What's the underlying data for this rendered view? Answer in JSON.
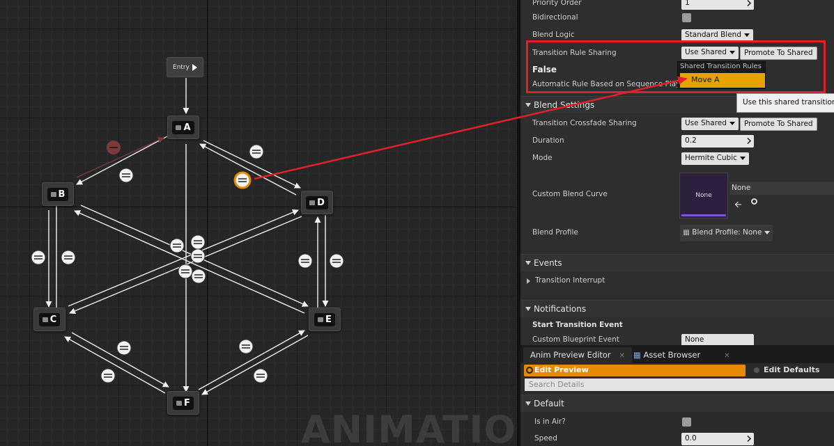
{
  "graph": {
    "entry_label": "Entry",
    "states": [
      "A",
      "B",
      "C",
      "D",
      "E",
      "F"
    ],
    "watermark": "ANIMATION"
  },
  "details": {
    "rows": {
      "priority_order": {
        "label": "Priority Order",
        "value": "1"
      },
      "bidirectional": {
        "label": "Bidirectional",
        "checked": false
      },
      "blend_logic": {
        "label": "Blend Logic",
        "value": "Standard Blend"
      },
      "transition_rule_sharing": {
        "label": "Transition Rule Sharing",
        "value": "Use Shared",
        "button": "Promote To Shared"
      },
      "false_label": "False",
      "automatic_rule": {
        "label": "Automatic Rule Based on Sequence Player"
      }
    },
    "dropdown": {
      "header": "Shared Transition Rules",
      "option": "Move A"
    },
    "tooltip": "Use this shared transition",
    "blend_settings": {
      "title": "Blend Settings",
      "crossfade_sharing": {
        "label": "Transition Crossfade Sharing",
        "value": "Use Shared",
        "button": "Promote To Shared"
      },
      "duration": {
        "label": "Duration",
        "value": "0.2"
      },
      "mode": {
        "label": "Mode",
        "value": "Hermite Cubic"
      },
      "custom_blend_curve": {
        "label": "Custom Blend Curve",
        "thumb": "None",
        "name": "None"
      },
      "blend_profile": {
        "label": "Blend Profile",
        "value": "Blend Profile: None"
      }
    },
    "events": {
      "title": "Events",
      "transition_interrupt": "Transition Interrupt"
    },
    "notifications": {
      "title": "Notifications",
      "start_event": "Start Transition Event",
      "custom_blueprint_event": {
        "label": "Custom Blueprint Event",
        "value": "None"
      }
    }
  },
  "bottom": {
    "tabs": [
      "Anim Preview Editor",
      "Asset Browser"
    ],
    "edit_preview": "Edit Preview",
    "edit_defaults": "Edit Defaults",
    "search_placeholder": "Search Details",
    "default_title": "Default",
    "is_in_air": {
      "label": "Is in Air?",
      "checked": false
    },
    "speed": {
      "label": "Speed",
      "value": "0.0"
    }
  },
  "colors": {
    "accent": "#e68a00",
    "highlight": "#e0202a",
    "menu_option": "#e6a300"
  }
}
